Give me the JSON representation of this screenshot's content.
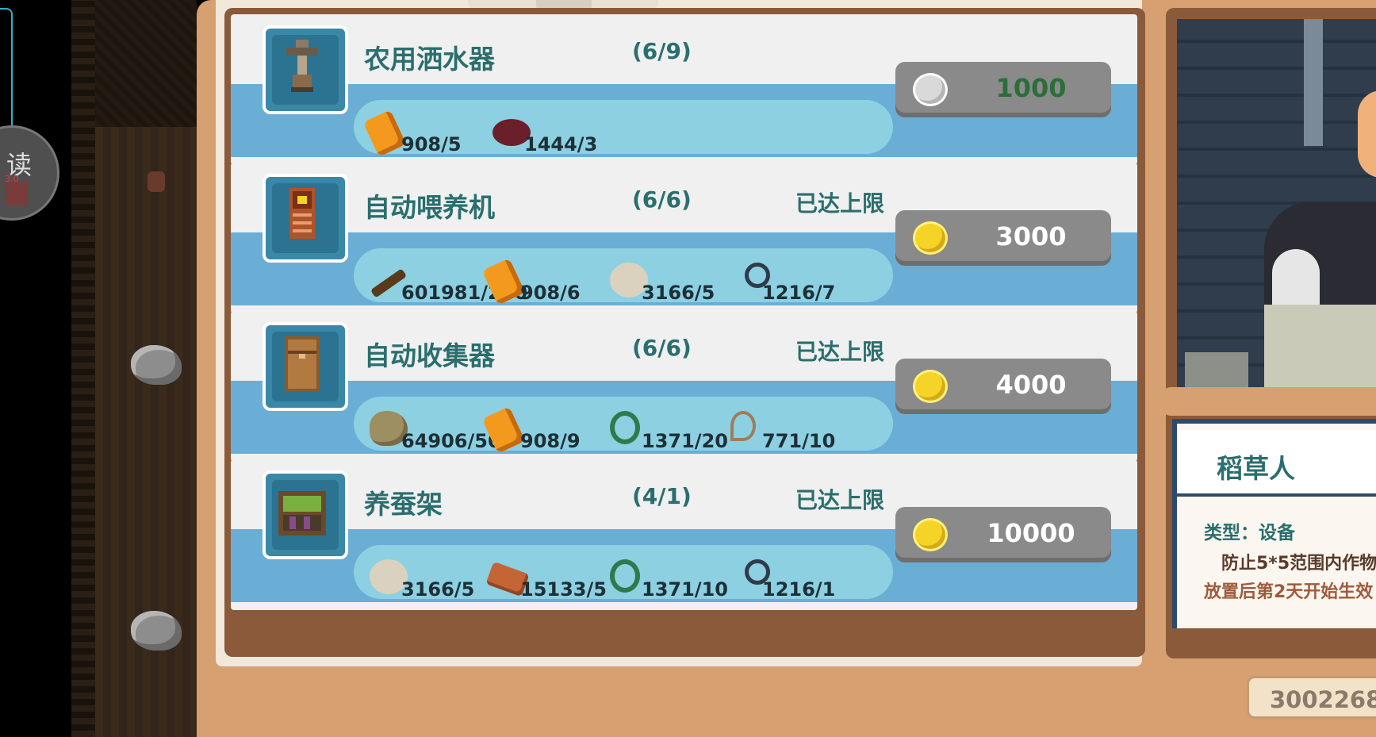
{
  "overlay": {
    "read_char": "读",
    "read_badge": "3.0"
  },
  "shop_items": [
    {
      "name": "农用洒水器",
      "count": "(6/9)",
      "limit": "",
      "price_coin": "silver-coin-icon",
      "price": "1000",
      "price_color": "#2b6e3a",
      "materials": [
        {
          "icon": "copper-ingot-icon",
          "text": "908/5"
        },
        {
          "icon": "meat-icon",
          "text": "1444/3"
        }
      ]
    },
    {
      "name": "自动喂养机",
      "count": "(6/6)",
      "limit": "已达上限",
      "price_coin": "gold-coin-icon",
      "price": "3000",
      "price_color": "#ffffff",
      "materials": [
        {
          "icon": "wood-log-icon",
          "text": "601981/250"
        },
        {
          "icon": "copper-ingot-icon",
          "text": "908/6"
        },
        {
          "icon": "wool-icon",
          "text": "3166/5"
        },
        {
          "icon": "magnifier-icon",
          "text": "1216/7"
        }
      ]
    },
    {
      "name": "自动收集器",
      "count": "(6/6)",
      "limit": "已达上限",
      "price_coin": "gold-coin-icon",
      "price": "4000",
      "price_color": "#ffffff",
      "materials": [
        {
          "icon": "stone-icon",
          "text": "64906/50"
        },
        {
          "icon": "copper-ingot-icon",
          "text": "908/9"
        },
        {
          "icon": "vine-icon",
          "text": "1371/20"
        },
        {
          "icon": "rope-icon",
          "text": "771/10"
        }
      ]
    },
    {
      "name": "养蚕架",
      "count": "(4/1)",
      "limit": "已达上限",
      "price_coin": "gold-coin-icon",
      "price": "10000",
      "price_color": "#ffffff",
      "materials": [
        {
          "icon": "wool-icon",
          "text": "3166/5"
        },
        {
          "icon": "brick-icon",
          "text": "15133/5"
        },
        {
          "icon": "vine-icon",
          "text": "1371/10"
        },
        {
          "icon": "magnifier-icon",
          "text": "1216/1"
        }
      ]
    }
  ],
  "detail": {
    "title": "稻草人",
    "type_line": "类型：设备",
    "desc_line1": "防止5*5范围内作物",
    "desc_line2": "放置后第2天开始生效"
  },
  "money": "3002268"
}
